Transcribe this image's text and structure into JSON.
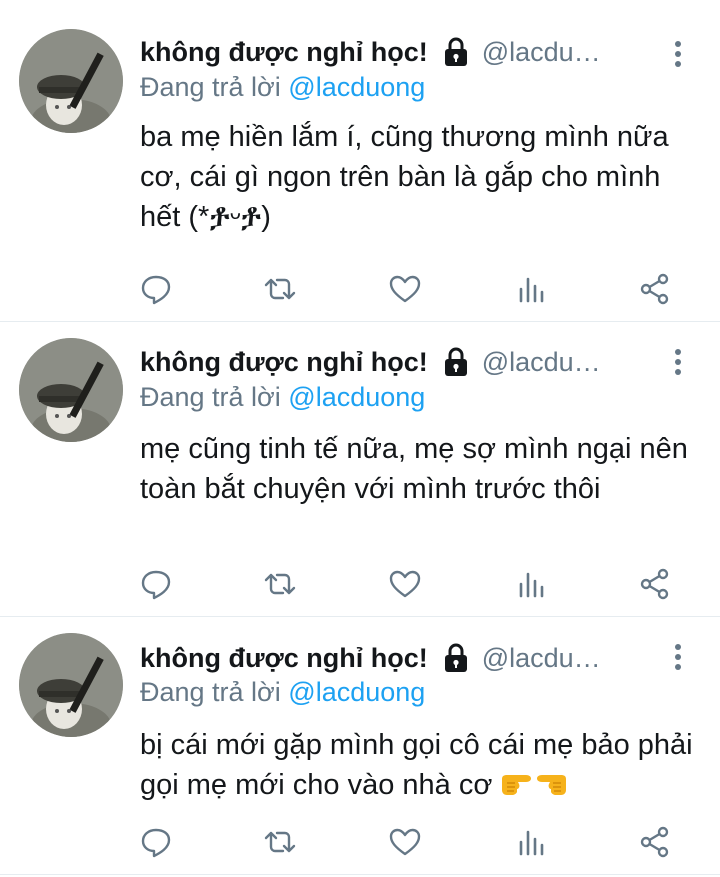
{
  "tweets": [
    {
      "display_name": "không được nghỉ học!",
      "handle": "@lacdu…",
      "reply_prefix": "Đang trả lời",
      "reply_mention": "@lacduong",
      "text": "ba mẹ hiền lắm í, cũng thương mình nữa cơ, cái gì ngon trên bàn là gắp cho mình hết (*ⶆᵕⶆ)",
      "emoji": []
    },
    {
      "display_name": "không được nghỉ học!",
      "handle": "@lacdu…",
      "reply_prefix": "Đang trả lời",
      "reply_mention": "@lacduong",
      "text": "mẹ cũng tinh tế nữa, mẹ sợ mình ngại nên toàn bắt chuyện với mình trước thôi",
      "emoji": []
    },
    {
      "display_name": "không được nghỉ học!",
      "handle": "@lacdu…",
      "reply_prefix": "Đang trả lời",
      "reply_mention": "@lacduong",
      "text": "bị cái mới gặp mình gọi cô cái mẹ bảo phải gọi mẹ mới cho vào nhà cơ",
      "emoji": [
        "pointing-right-emoji",
        "pointing-left-emoji"
      ]
    }
  ],
  "icons": {
    "lock": "lock-icon",
    "more": "more-vertical-icon",
    "reply": "reply-icon",
    "retweet": "retweet-icon",
    "like": "heart-icon",
    "stats": "analytics-icon",
    "share": "share-icon"
  },
  "colors": {
    "text": "#14171a",
    "secondary": "#657786",
    "mention": "#1da1f2",
    "divider": "#e6ecf0"
  }
}
